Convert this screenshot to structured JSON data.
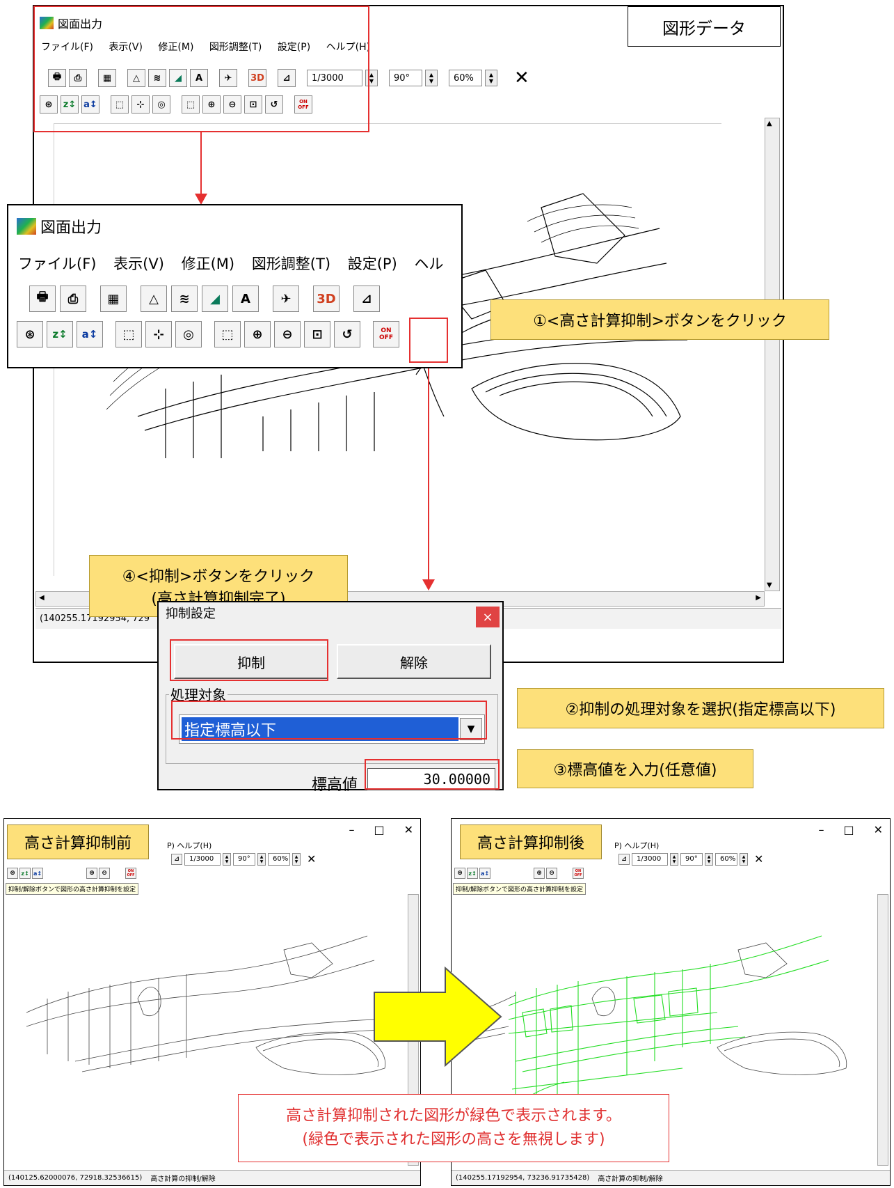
{
  "top_label": "図形データ",
  "app_title": "図面出力",
  "menu": [
    "ファイル(F)",
    "表示(V)",
    "修正(M)",
    "図形調整(T)",
    "設定(P)",
    "ヘルプ(H)"
  ],
  "menu_zoomed": [
    "ファイル(F)",
    "表示(V)",
    "修正(M)",
    "図形調整(T)",
    "設定(P)",
    "ヘル"
  ],
  "toolbar": {
    "scale": "1/3000",
    "angle": "90°",
    "zoom": "60%",
    "close": "✕",
    "btn_3d": "3D",
    "btn_a": "A",
    "suppress_on": "ON",
    "suppress_off": "OFF"
  },
  "status_coords_top": "(140255.17192954, 729",
  "callouts": {
    "step1": "①<高さ計算抑制>ボタンをクリック",
    "step2": "②抑制の処理対象を選択(指定標高以下)",
    "step3": "③標高値を入力(任意値)",
    "step4_line1": "④<抑制>ボタンをクリック",
    "step4_line2": "(高さ計算抑制完了)"
  },
  "dialog": {
    "title": "抑制設定",
    "close": "×",
    "suppress_button": "抑制",
    "release_button": "解除",
    "group_label": "処理対象",
    "target_selected": "指定標高以下",
    "elevation_label": "標高値",
    "elevation_value": "30.00000"
  },
  "before": {
    "tag": "高さ計算抑制前",
    "tooltip": "抑制/解除ボタンで図形の高さ計算抑制を設定",
    "status_coords": "(140125.62000076, 72918.32536615)",
    "status_text": "高さ計算の抑制/解除",
    "menu_tail": "P) ヘルプ(H)"
  },
  "after": {
    "tag": "高さ計算抑制後",
    "tooltip": "抑制/解除ボタンで図形の高さ計算抑制を設定",
    "status_coords": "(140255.17192954, 73236.91735428)",
    "status_text": "高さ計算の抑制/解除",
    "menu_tail": "P) ヘルプ(H)"
  },
  "window_controls": {
    "minimize": "–",
    "maximize": "□",
    "close": "✕"
  },
  "bottom_note": {
    "line1": "高さ計算抑制された図形が緑色で表示されます。",
    "line2": "(緑色で表示された図形の高さを無視します)"
  },
  "colors": {
    "callout": "#fde07a",
    "highlight": "#e53030",
    "suppressed": "#22dd22",
    "selection": "#1f5fd6",
    "arrow_fill": "#ffff00"
  }
}
